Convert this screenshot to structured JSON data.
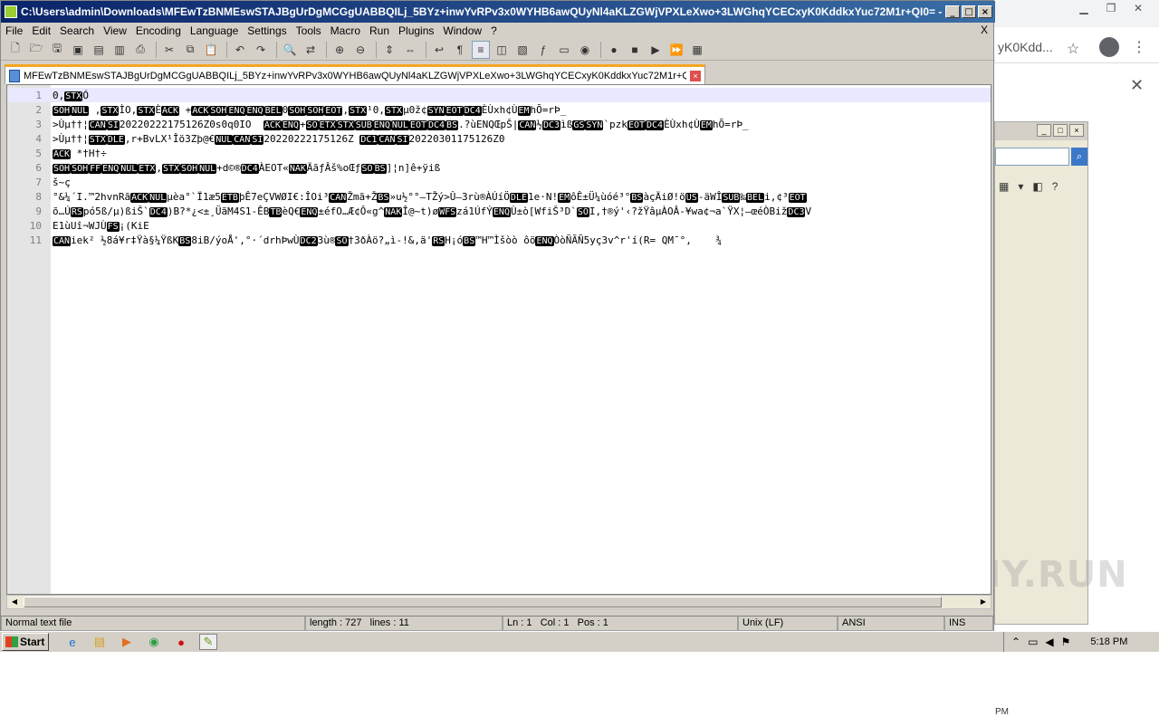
{
  "window": {
    "title": "C:\\Users\\admin\\Downloads\\MFEwTzBNMEswSTAJBgUrDgMCGgUABBQILj_5BYz+inwYvRPv3x0WYHB6awQUyNl4aKLZGWjVPXLeXwo+3LWGhqYCECxyK0KddkxYuc72M1r+QI0= - Note..."
  },
  "menu": [
    "File",
    "Edit",
    "Search",
    "View",
    "Encoding",
    "Language",
    "Settings",
    "Tools",
    "Macro",
    "Run",
    "Plugins",
    "Window",
    "?"
  ],
  "menu_close": "X",
  "tab": {
    "label": "MFEwTzBNMEswSTAJBgUrDgMCGgUABBQILj_5BYz+inwYvRPv3x0WYHB6awQUyNl4aKLZGWjVPXLeXwo+3LWGhqYCECxyK0KddkxYuc72M1r+QI0=",
    "close": "×"
  },
  "editor": {
    "lines": [
      {
        "num": "1",
        "text": "0,[STX]Ó"
      },
      {
        "num": "2",
        "text": "[SOH][NUL] ,[STX]ÌO,[STX]È[ACK] +[ACK][SOH][ENQ][ENQ][BEL]0[SOH][SOH][EOT],[STX]¹0,[STX]µ0ž¢[SYN][EOT][DC4]ÈÙxh¢Ù[EM]hÕ=rÞ_"
      },
      {
        "num": "3",
        "text": ">Ùµ††¦[CAN][SI]20220222175126Z0s0q0IO  [ACK][ENQ]+[SO][ETX][STX][SUB][ENQ][NUL][EOT][DC4][BS].?ùENQŒpŠ|[CAN]½[DC3]ìß[GS][SYN]`pzk[EOT][DC4]ÈÙxh¢Ù[EM]hÕ=rÞ_"
      },
      {
        "num": "4",
        "text": ">Ùµ††¦[STX][DLE],r+BvLX¹Îö3Zþ@€[NUL][CAN][SI]20220222175126Z [DC1][CAN][SI]20220301175126Z0"
      },
      {
        "num": "5",
        "text": "[ACK] *†H†÷"
      },
      {
        "num": "6",
        "text": "[SOH][SOH][FF][ENQ][NUL][ETX],[STX][SOH][NUL]+d©®[DC4]ÀEOT«[NAK]ÄãƒÂš%oŒƒ[SO][BS]]¦n]ê+ÿiß"
      },
      {
        "num": "7",
        "text": "š~ç"
      },
      {
        "num": "8",
        "text": "°&¼´I.™2hvnRã[ACK][NUL]µèa°`Ï1æ5[ETB]þÊ7eÇVWØI€:ÎOi³[CAN]Žmã+Ž[BS]»u½°°–TŽý>Û–3rù®ÀÚíÖ[DLE]1e·N![EM]ôÊ±Ü¼ùóé³°[BS]àçÄiØ!ö[US]-äWÎ[SUB]‰[BEL]i,¢³[EOT]"
      },
      {
        "num": "9",
        "text": "õ…Ú[RS]pó5ß/µ)ßiŠ`[DC4])B?*¿<±¸ÜãM4S1-ÊB[TB]èQ€[ENQ]±éfO…Æ¢Ô«g^[NAK]Î@~t)ø[WFS]zá1ÚfÝ[ENQ]Ù±ò[WfiŠ³D`[SO]I,†®ý'‹?žŸâµÀOÂ-¥wa¢¬a`ŸX¦–œéÒBiž[DC3]V"
      },
      {
        "num": "10",
        "text": "E1ùUî¬WJÙ[FS]¡(KiE"
      },
      {
        "num": "11",
        "text": "[CAN]iek² ½8á¥r‡Ÿà§¼ŸßK[BS]8iB/ýoÅ',°·´drhÞwÙ[DC2]3ù®[SO]†3ðÀö?„ì-!&,ä'[RS]H¡ó[BS]™H™Ìšòò ôö[ENQ]ÒòÑÃÑ5yç3v^r'í(R= QM¯°,    ¾"
      }
    ]
  },
  "statusbar": {
    "filetype": "Normal text file",
    "length": "length : 727",
    "lines": "lines : 11",
    "ln": "Ln : 1",
    "col": "Col : 1",
    "pos": "Pos : 1",
    "eol": "Unix (LF)",
    "encoding": "ANSI",
    "mode": "INS"
  },
  "background_browser": {
    "address_fragment": "yK0Kdd...",
    "pm_label": "PM"
  },
  "watermark": "ANY.RUN",
  "taskbar": {
    "start_label": "Start",
    "clock": "5:18 PM"
  }
}
